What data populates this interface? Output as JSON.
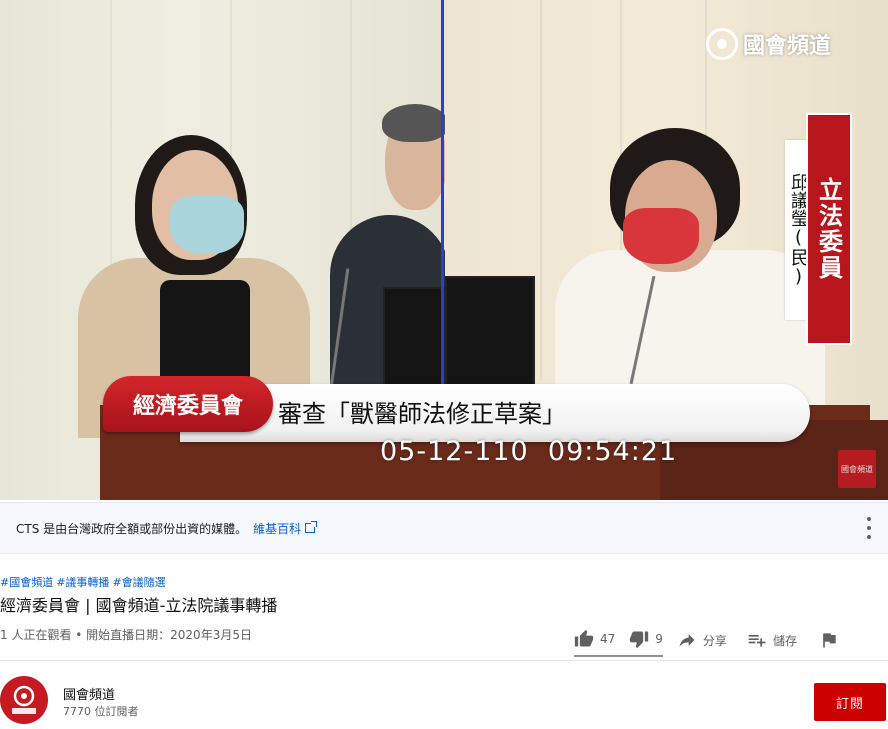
{
  "video": {
    "watermark_text": "國會頻道",
    "legislator_title": "立法委員",
    "legislator_name": "邱議瑩(民)",
    "committee_label": "經濟委員會",
    "agenda_text": "審查「獸醫師法修正草案」",
    "timecode": "05-12-110  09:54:21",
    "mini_logo_text": "國會頻道"
  },
  "banner": {
    "text": "CTS 是由台灣政府全額或部份出資的媒體。",
    "link_label": "維基百科"
  },
  "info": {
    "tags": [
      "#國會頻道",
      "#議事轉播",
      "#會議隨選"
    ],
    "title": "經濟委員會 | 國會頻道-立法院議事轉播",
    "meta": "1 人正在觀看 • 開始直播日期：2020年3月5日"
  },
  "actions": {
    "like_count": "47",
    "dislike_count": "9",
    "share_label": "分享",
    "save_label": "儲存"
  },
  "channel": {
    "name": "國會頻道",
    "subscribers": "7770 位訂閱者",
    "avatar_text": "國會頻道",
    "subscribe_label": "訂閱"
  },
  "colors": {
    "accent_red": "#cc0000",
    "link_blue": "#065fd4",
    "banner_bg": "#f5f8fd"
  }
}
